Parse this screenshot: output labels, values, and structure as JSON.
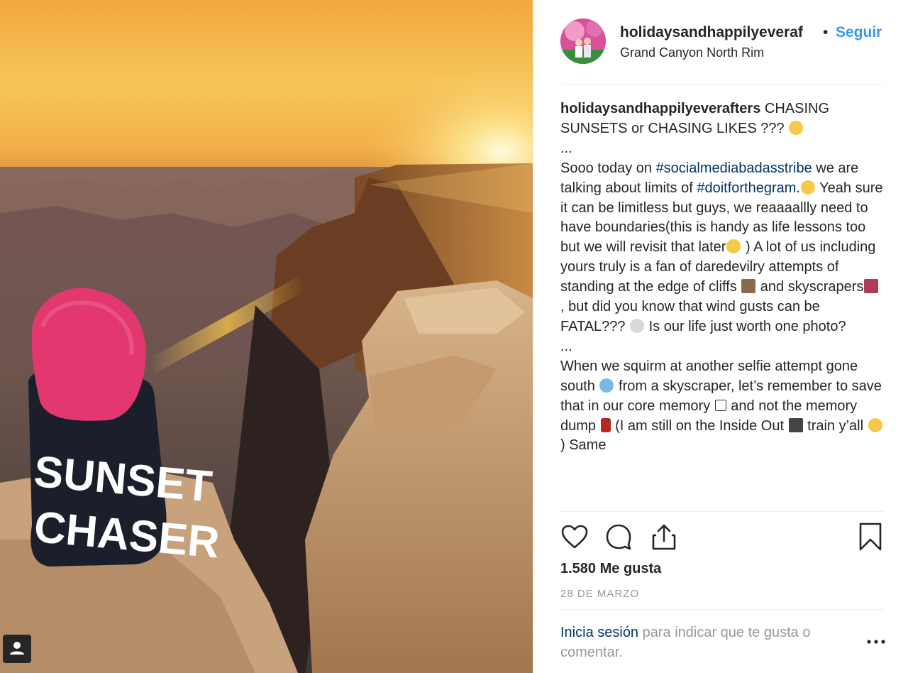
{
  "post": {
    "username": "holidaysandhappilyeveraf",
    "separator": "•",
    "follow_label": "Seguir",
    "location": "Grand Canyon North Rim",
    "photo_text": {
      "line1": "SUNSET",
      "line2": "CHASER"
    }
  },
  "caption": {
    "author": "holidaysandhappilyeverafters",
    "t1": " CHASING SUNSETS or CHASING LIKES ??? ",
    "t2": "...",
    "t3": "Sooo today on ",
    "hashtag1": "#socialmediabadasstribe",
    "t4": " we are talking about limits of ",
    "hashtag2": "#doitforthegram",
    "t5": ".",
    "t6": " Yeah sure it can be limitless but guys, we reaaaallly need to have boundaries(this is handy as life lessons too but we will revisit that later",
    "t7": " ) A lot of us including yours truly is a fan of daredevilry attempts of standing at the edge of cliffs ",
    "t8": " and skyscrapers",
    "t9": " , but did you know that wind gusts can be FATAL??? ",
    "t10": "  Is our life just worth one photo?",
    "t11": "...",
    "t12": "When we squirm at another selfie attempt gone south ",
    "t13": "  from a skyscraper, let’s remember to save that in our core memory ",
    "t14": " and not the memory dump ",
    "t15": "  (I am still on the Inside Out ",
    "t16": "  train y’all ",
    "t17": " ) Same"
  },
  "icons": {
    "like": "heart-icon",
    "comment": "comment-icon",
    "share": "share-icon",
    "save": "bookmark-icon",
    "more": "ellipsis-icon",
    "tag": "user-tag-icon"
  },
  "stats": {
    "likes": "1.580 Me gusta",
    "date": "28 DE MARZO"
  },
  "login_prompt": {
    "link": "Inicia sesión",
    "text": " para indicar que te gusta o comentar."
  },
  "colors": {
    "link_blue": "#3897f0",
    "hashtag": "#003569",
    "text": "#262626",
    "muted": "#999999"
  }
}
